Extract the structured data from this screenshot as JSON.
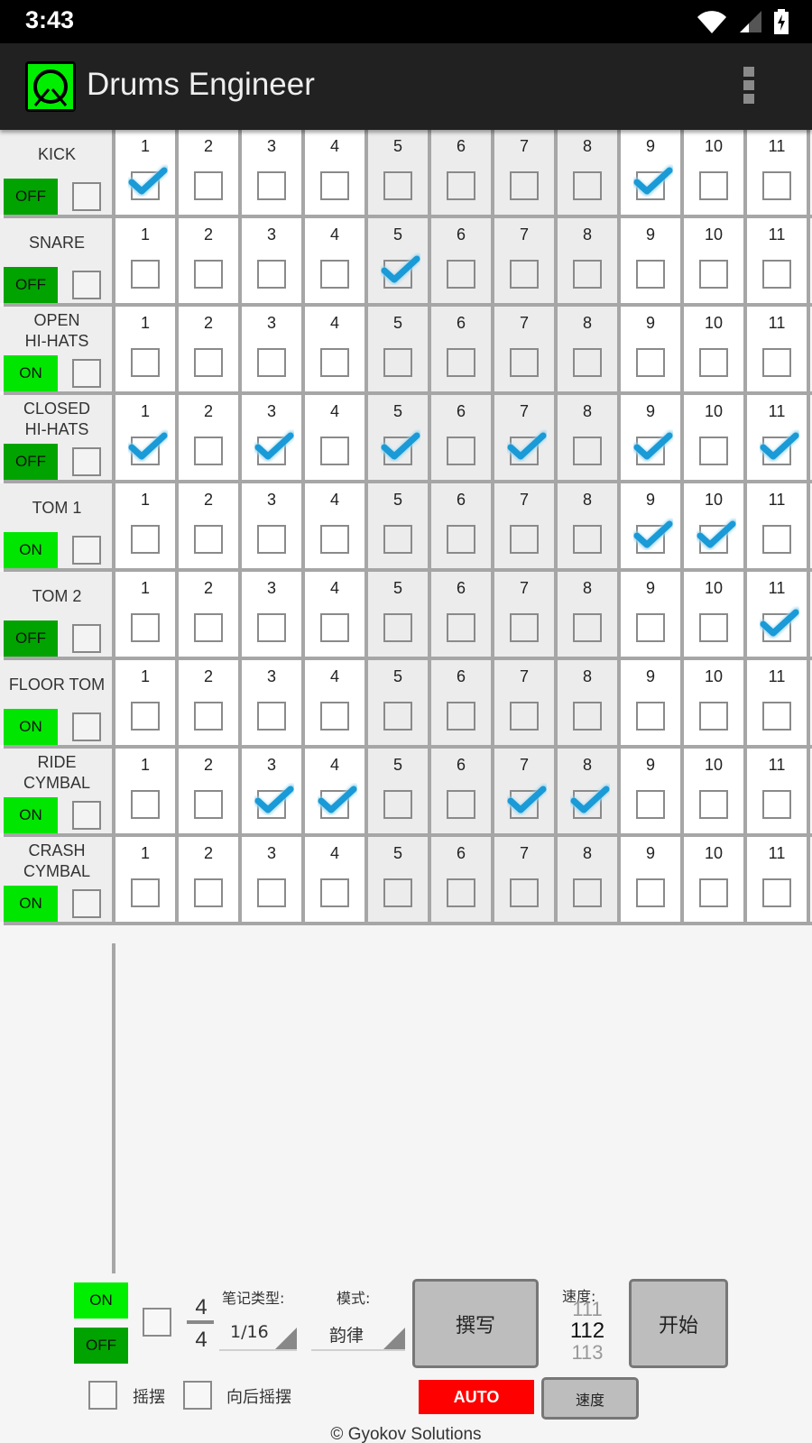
{
  "status_bar": {
    "time": "3:43",
    "icons": [
      "wifi-icon",
      "signal-icon",
      "battery-charging-icon"
    ]
  },
  "app_bar": {
    "title": "Drums Engineer",
    "logo_icon": "drum-logo-icon",
    "menu_icon": "overflow-menu-icon"
  },
  "colors": {
    "on_green": "#00e600",
    "off_green": "#00a300",
    "check_blue": "#1a9ad6",
    "auto_red": "#ff0000",
    "grid_line": "#a6a6a6",
    "shaded_column": "#ececec"
  },
  "steps": [
    "1",
    "2",
    "3",
    "4",
    "5",
    "6",
    "7",
    "8",
    "9",
    "10",
    "11"
  ],
  "shaded_steps": [
    5,
    6,
    7,
    8
  ],
  "tracks": [
    {
      "name": "KICK",
      "state": "OFF",
      "checked": [
        1,
        9
      ]
    },
    {
      "name": "SNARE",
      "state": "OFF",
      "checked": [
        5
      ]
    },
    {
      "name": "OPEN\nHI-HATS",
      "state": "ON",
      "checked": []
    },
    {
      "name": "CLOSED\nHI-HATS",
      "state": "OFF",
      "checked": [
        1,
        3,
        5,
        7,
        9,
        11
      ]
    },
    {
      "name": "TOM 1",
      "state": "ON",
      "checked": [
        9,
        10
      ]
    },
    {
      "name": "TOM 2",
      "state": "OFF",
      "checked": [
        11
      ]
    },
    {
      "name": "FLOOR TOM",
      "state": "ON",
      "checked": []
    },
    {
      "name": "RIDE\nCYMBAL",
      "state": "ON",
      "checked": [
        3,
        4,
        7,
        8
      ]
    },
    {
      "name": "CRASH\nCYMBAL",
      "state": "ON",
      "checked": []
    }
  ],
  "controls": {
    "on_label": "ON",
    "off_label": "OFF",
    "time_sig_top": "4",
    "time_sig_bottom": "4",
    "note_type_label": "笔记类型:",
    "note_type_value": "1/16",
    "mode_label": "模式:",
    "mode_value": "韵律",
    "compose_button": "撰写",
    "tempo_label": "速度:",
    "tempo_prev": "111",
    "tempo_current": "112",
    "tempo_next": "113",
    "start_button": "开始",
    "swing_label": "摇摆",
    "back_swing_label": "向后摇摆",
    "auto_button": "AUTO",
    "speed_button": "速度"
  },
  "footer": "© Gyokov Solutions"
}
